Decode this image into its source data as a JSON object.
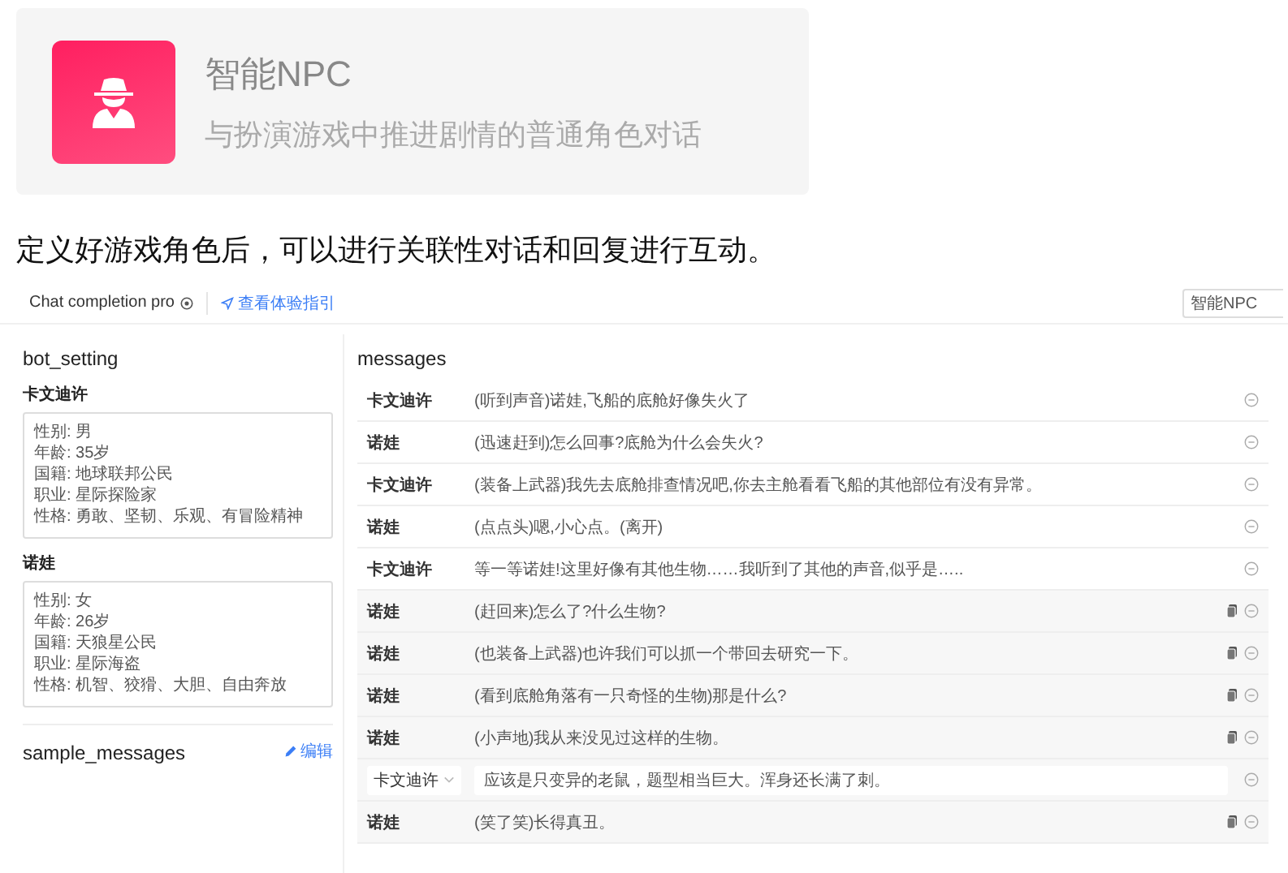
{
  "feature_card": {
    "title": "智能NPC",
    "description": "与扮演游戏中推进剧情的普通角色对话"
  },
  "caption": "定义好游戏角色后，可以进行关联性对话和回复进行互动。",
  "app": {
    "header": {
      "title": "Chat completion pro",
      "guide_link": "查看体验指引",
      "model_field": {
        "value": "智能NPC"
      }
    },
    "bot_setting": {
      "title": "bot_setting",
      "characters": [
        {
          "name": "卡文迪许",
          "profile": [
            "性别: 男",
            "年龄: 35岁",
            "国籍: 地球联邦公民",
            "职业: 星际探险家",
            "性格: 勇敢、坚韧、乐观、有冒险精神"
          ]
        },
        {
          "name": "诺娃",
          "profile": [
            "性别: 女",
            "年龄: 26岁",
            "国籍: 天狼星公民",
            "职业: 星际海盗",
            "性格: 机智、狡猾、大胆、自由奔放"
          ]
        }
      ]
    },
    "sample_messages": {
      "title": "sample_messages",
      "edit_link": "编辑"
    },
    "messages": {
      "title": "messages",
      "rows": [
        {
          "kind": "plain",
          "speaker": "卡文迪许",
          "text": "(听到声音)诺娃,飞船的底舱好像失火了"
        },
        {
          "kind": "plain",
          "speaker": "诺娃",
          "text": "(迅速赶到)怎么回事?底舱为什么会失火?"
        },
        {
          "kind": "plain",
          "speaker": "卡文迪许",
          "text": "(装备上武器)我先去底舱排查情况吧,你去主舱看看飞船的其他部位有没有异常。"
        },
        {
          "kind": "plain",
          "speaker": "诺娃",
          "text": "(点点头)嗯,小心点。(离开)"
        },
        {
          "kind": "plain",
          "speaker": "卡文迪许",
          "text": "等一等诺娃!这里好像有其他生物……我听到了其他的声音,似乎是….."
        },
        {
          "kind": "copyable",
          "speaker": "诺娃",
          "text": "(赶回来)怎么了?什么生物?"
        },
        {
          "kind": "copyable",
          "speaker": "诺娃",
          "text": "(也装备上武器)也许我们可以抓一个带回去研究一下。"
        },
        {
          "kind": "copyable",
          "speaker": "诺娃",
          "text": "(看到底舱角落有一只奇怪的生物)那是什么?"
        },
        {
          "kind": "copyable",
          "speaker": "诺娃",
          "text": "(小声地)我从来没见过这样的生物。"
        },
        {
          "kind": "editing",
          "speaker": "卡文迪许",
          "text": "应该是只变异的老鼠，题型相当巨大。浑身还长满了刺。"
        },
        {
          "kind": "copyable",
          "speaker": "诺娃",
          "text": "(笑了笑)长得真丑。"
        }
      ]
    }
  }
}
